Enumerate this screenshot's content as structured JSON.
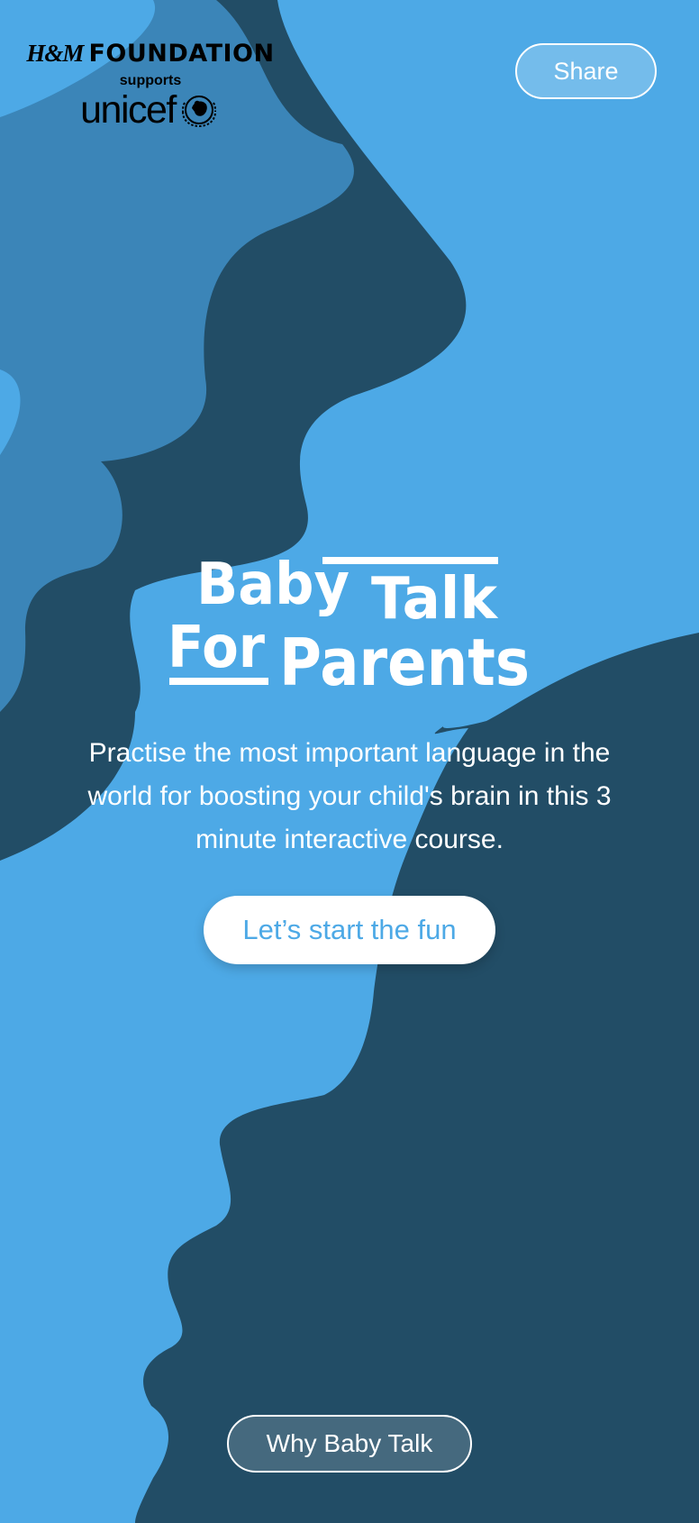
{
  "branding": {
    "hm_mark": "H&M",
    "hm_word": "FOUNDATION",
    "supports": "supports",
    "unicef": "unicef"
  },
  "header": {
    "share_label": "Share"
  },
  "hero": {
    "title_baby": "Baby",
    "title_talk": "Talk",
    "title_for": "For",
    "title_parents": "Parents",
    "intro_text": "Practise the most important language in the world for boosting your child's brain in this 3 minute interactive course.",
    "cta_label": "Let’s start the fun"
  },
  "footer": {
    "why_label": "Why Baby Talk"
  },
  "colors": {
    "background": "#4da9e6",
    "shape_dark": "#224d66",
    "shape_mid": "#3b85b8",
    "text_on_blue": "#ffffff",
    "cta_text": "#4da9e6"
  }
}
